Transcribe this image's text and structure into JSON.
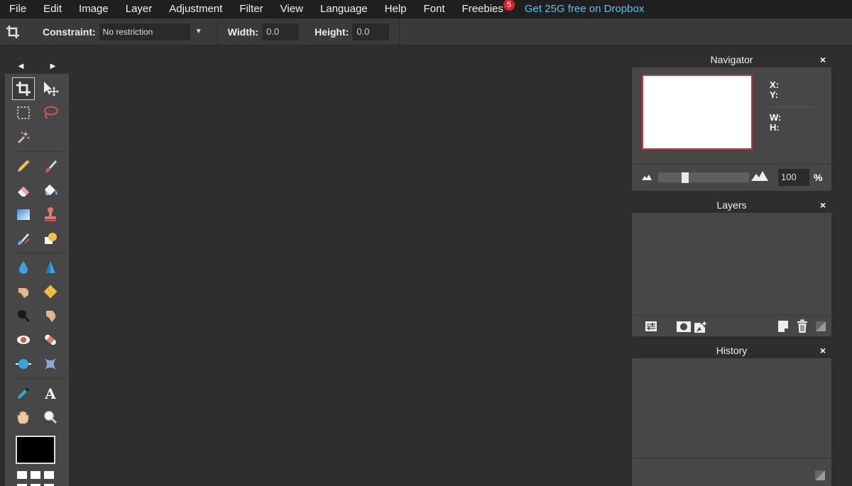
{
  "menubar": {
    "items": [
      "File",
      "Edit",
      "Image",
      "Layer",
      "Adjustment",
      "Filter",
      "View",
      "Language",
      "Help",
      "Font",
      "Freebies"
    ],
    "freebies_badge": "5",
    "promo_link": "Get 25G free on Dropbox"
  },
  "options": {
    "tool_icon": "crop-icon",
    "constraint_label": "Constraint:",
    "constraint_value": "No restriction",
    "width_label": "Width:",
    "width_value": "0.0",
    "height_label": "Height:",
    "height_value": "0.0"
  },
  "toolbox": {
    "active_tool": "crop-tool",
    "tools": [
      "crop-tool",
      "move-tool",
      "marquee-tool",
      "lasso-tool",
      "magic-wand-tool",
      "pencil-tool",
      "brush-tool",
      "eraser-tool",
      "paint-bucket-tool",
      "gradient-tool",
      "clone-stamp-tool",
      "color-replace-tool",
      "shape-tool",
      "blur-tool",
      "sharpen-tool",
      "smudge-tool",
      "sponge-tool",
      "dodge-tool",
      "burn-tool",
      "red-eye-tool",
      "spot-heal-tool",
      "bloat-tool",
      "pinch-tool",
      "color-picker-tool",
      "type-tool",
      "hand-tool",
      "zoom-tool"
    ],
    "foreground_color": "#000000"
  },
  "navigator": {
    "title": "Navigator",
    "x_label": "X:",
    "y_label": "Y:",
    "w_label": "W:",
    "h_label": "H:",
    "zoom_value": "100",
    "zoom_unit": "%",
    "zoom_slider_fraction": 0.28
  },
  "layers": {
    "title": "Layers"
  },
  "history": {
    "title": "History"
  },
  "colors": {
    "menubar_bg": "#1f1f1f",
    "workspace_bg": "#2e2e2e",
    "panel_bg": "#474747",
    "promo": "#5cc3e8",
    "badge": "#d8262b",
    "nav_frame": "#c9343a"
  }
}
